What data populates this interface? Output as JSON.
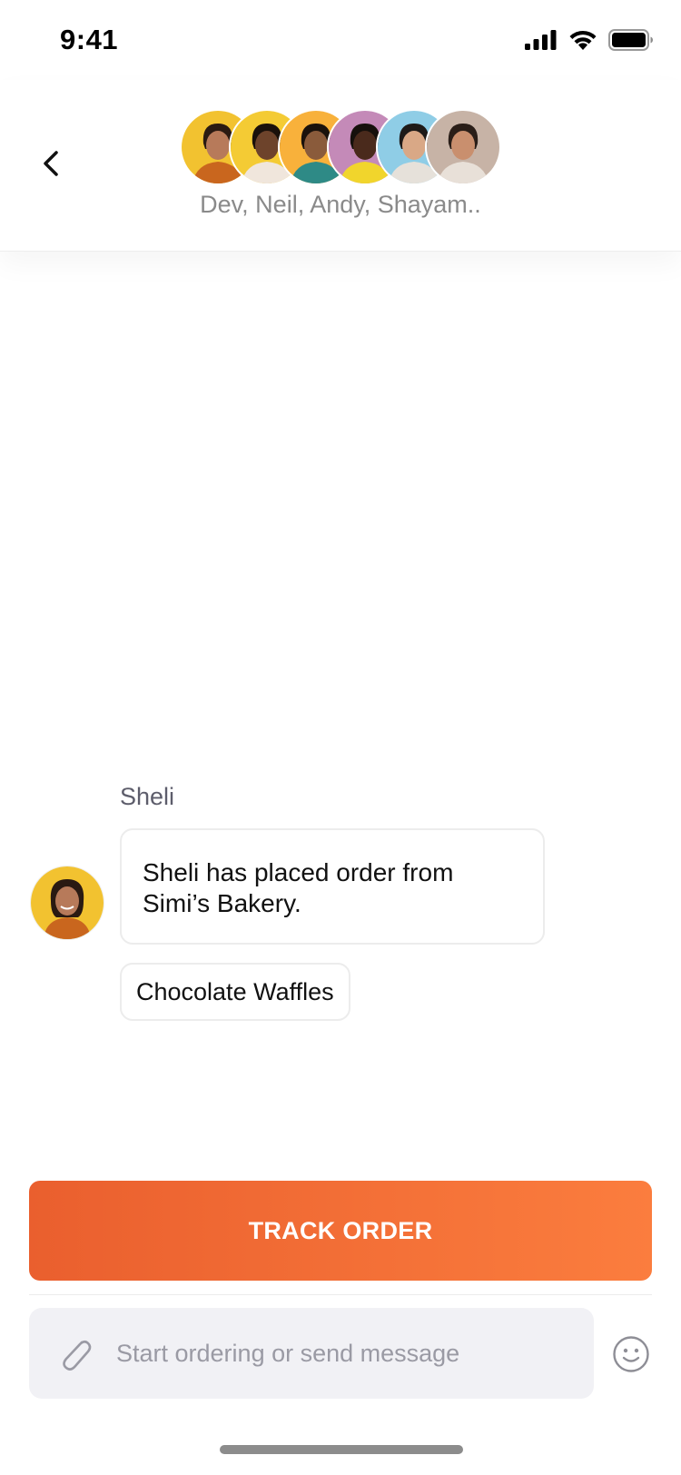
{
  "status_bar": {
    "time": "9:41"
  },
  "header": {
    "participants": "Dev, Neil, Andy, Shayam..",
    "avatars": [
      {
        "name": "avatar-1",
        "bg": "#f2c230",
        "skin": "#b77a5a",
        "hair": "#2a1a12",
        "shirt": "#c9661e"
      },
      {
        "name": "avatar-2",
        "bg": "#f4cb34",
        "skin": "#6d432b",
        "hair": "#1a110b",
        "shirt": "#f0e6dc"
      },
      {
        "name": "avatar-3",
        "bg": "#f8b13b",
        "skin": "#8a5b3b",
        "hair": "#1a120c",
        "shirt": "#2e8a86"
      },
      {
        "name": "avatar-4",
        "bg": "#c48ab8",
        "skin": "#4a2a1c",
        "hair": "#16100c",
        "shirt": "#f1d52c"
      },
      {
        "name": "avatar-5",
        "bg": "#8fcde6",
        "skin": "#d9a886",
        "hair": "#1e1a18",
        "shirt": "#e6e1da"
      },
      {
        "name": "avatar-6",
        "bg": "#c7b3a6",
        "skin": "#c98f6e",
        "hair": "#2a1e18",
        "shirt": "#e8e0d8"
      }
    ]
  },
  "message": {
    "sender": "Sheli",
    "text": "Sheli has placed order from Simi’s Bakery.",
    "item": "Chocolate Waffles"
  },
  "actions": {
    "track_order": "TRACK ORDER"
  },
  "composer": {
    "placeholder": "Start ordering or send message"
  },
  "colors": {
    "accent_start": "#ea5f2e",
    "accent_end": "#fb7d3e",
    "input_bg": "#f1f1f5"
  }
}
